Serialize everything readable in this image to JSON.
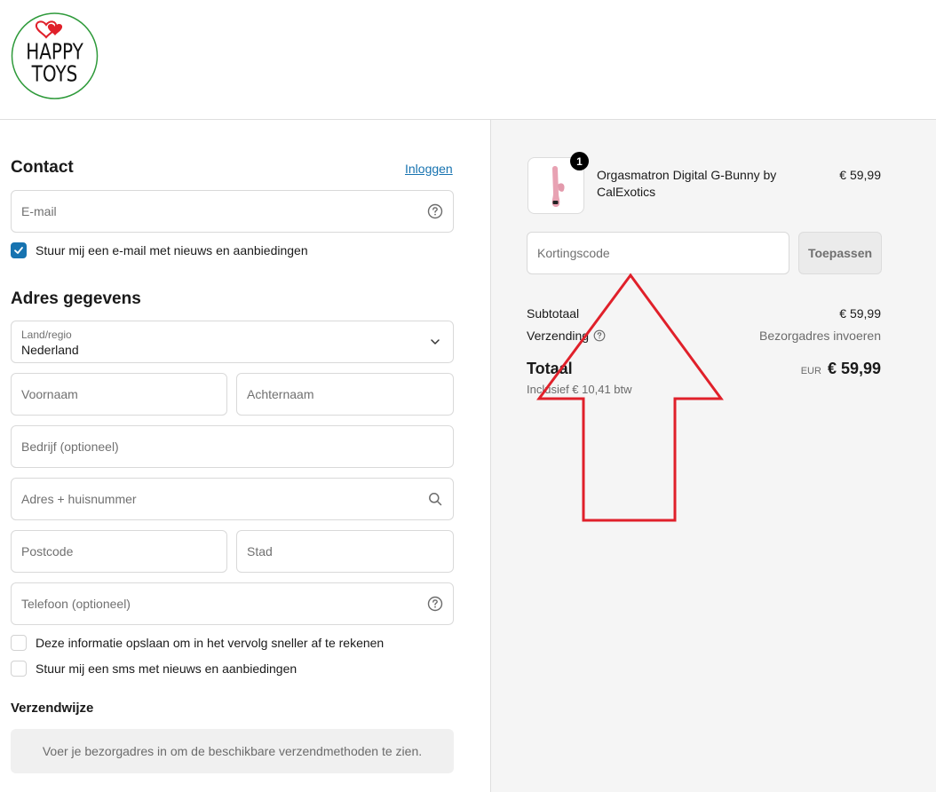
{
  "brand": {
    "logo_line1": "HAPPY",
    "logo_line2": "TOYS"
  },
  "contact": {
    "title": "Contact",
    "login_link": "Inloggen",
    "email_placeholder": "E-mail",
    "newsletter_label": "Stuur mij een e-mail met nieuws en aanbiedingen",
    "newsletter_checked": true
  },
  "address": {
    "title": "Adres gegevens",
    "country_label": "Land/regio",
    "country_value": "Nederland",
    "first_name_placeholder": "Voornaam",
    "last_name_placeholder": "Achternaam",
    "company_placeholder": "Bedrijf (optioneel)",
    "street_placeholder": "Adres + huisnummer",
    "postcode_placeholder": "Postcode",
    "city_placeholder": "Stad",
    "phone_placeholder": "Telefoon (optioneel)",
    "save_info_label": "Deze informatie opslaan om in het vervolg sneller af te rekenen",
    "sms_label": "Stuur mij een sms met nieuws en aanbiedingen"
  },
  "shipping": {
    "title": "Verzendwijze",
    "info": "Voer je bezorgadres in om de beschikbare verzendmethoden te zien."
  },
  "summary": {
    "product_name": "Orgasmatron Digital G-Bunny by CalExotics",
    "product_qty": "1",
    "product_price": "€ 59,99",
    "discount_placeholder": "Kortingscode",
    "apply_label": "Toepassen",
    "subtotal_label": "Subtotaal",
    "subtotal_value": "€ 59,99",
    "shipping_label": "Verzending",
    "shipping_value": "Bezorgadres invoeren",
    "total_label": "Totaal",
    "currency": "EUR",
    "total_value": "€ 59,99",
    "tax_note": "Inclusief € 10,41 btw"
  },
  "colors": {
    "accent": "#1773b0",
    "annotation_red": "#e0202a",
    "logo_green": "#2e9a3a",
    "logo_heart": "#e0202a"
  }
}
